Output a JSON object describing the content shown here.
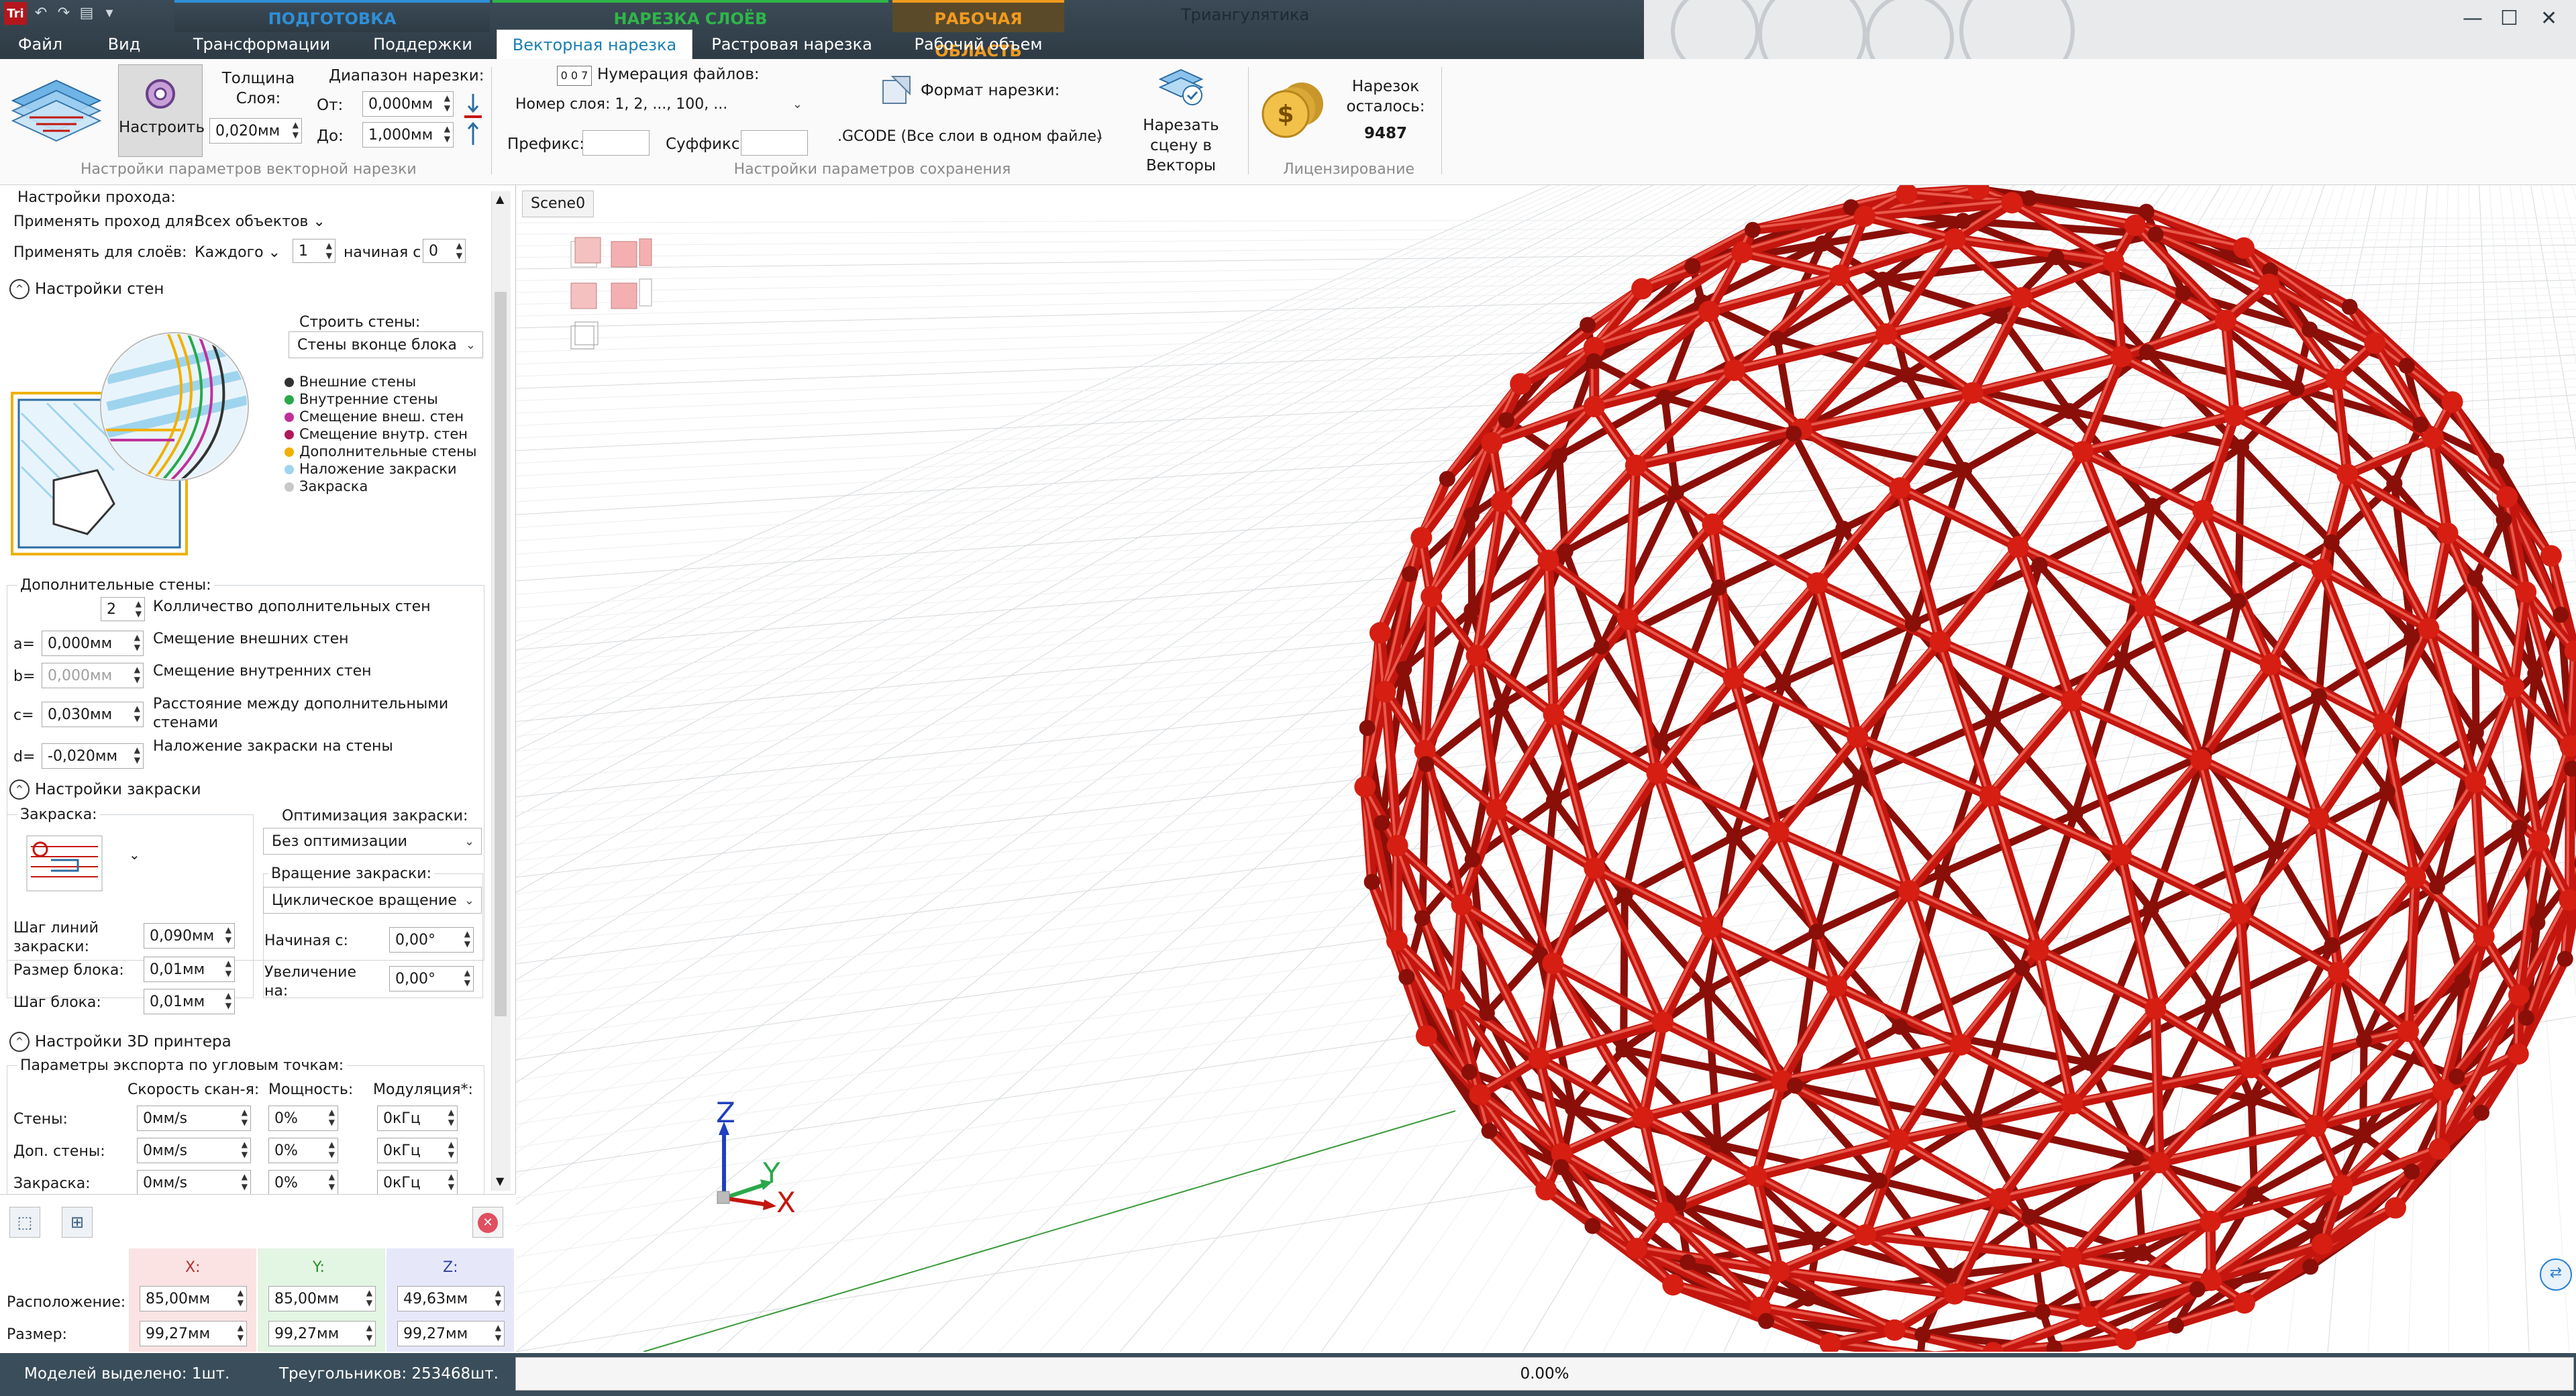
{
  "window": {
    "title": "Триангулятика"
  },
  "quick_access": {
    "logo": "Tri",
    "icons": [
      "undo-icon",
      "redo-icon",
      "flag-icon",
      "dropdown-icon"
    ]
  },
  "context_groups": [
    {
      "label": "ПОДГОТОВКА",
      "color": "#2f8fd8"
    },
    {
      "label": "НАРЕЗКА СЛОЁВ",
      "color": "#2fb54a"
    },
    {
      "label": "РАБОЧАЯ ОБЛАСТЬ",
      "color": "#f29a1f"
    }
  ],
  "tabs": [
    "Файл",
    "Вид",
    "Трансформации",
    "Поддержки",
    "Векторная нарезка",
    "Растровая нарезка",
    "Рабочий объем"
  ],
  "active_tab": "Векторная нарезка",
  "ribbon": {
    "configure_label": "Настроить",
    "layer_thickness_label": "Толщина Слоя:",
    "layer_thickness_value": "0,020мм",
    "range_label": "Диапазон нарезки:",
    "from_label": "От:",
    "from_value": "0,000мм",
    "to_label": "До:",
    "to_value": "1,000мм",
    "group1_label": "Настройки параметров векторной нарезки",
    "file_numbering_label": "Нумерация файлов:",
    "file_numbering_icon_text": "0 0 7",
    "layer_number_value": "Номер слоя: 1, 2, ..., 100, ...",
    "prefix_label": "Префикс:",
    "suffix_label": "Суффикс:",
    "format_label": "Формат нарезки:",
    "format_value": ".GCODE (Все слои в одном файле)",
    "slice_scene_label": "Нарезать сцену в Векторы",
    "group2_label": "Настройки параметров сохранения",
    "slices_left_label": "Нарезок осталось:",
    "slices_left_value": "9487",
    "group3_label": "Лицензирование"
  },
  "left": {
    "pass_settings": "Настройки прохода:",
    "apply_for_label": "Применять проход для:",
    "apply_for_value": "Всех объектов",
    "apply_layers_label": "Применять для слоёв:",
    "apply_layers_value": "Каждого",
    "layer_step": "1",
    "starting_label": "начиная с",
    "starting_value": "0",
    "walls_section": "Настройки стен",
    "build_walls_label": "Строить стены:",
    "build_walls_value": "Стены вконце блока",
    "legend": [
      {
        "label": "Внешние стены",
        "color": "#333333"
      },
      {
        "label": "Внутренние стены",
        "color": "#2aa84a"
      },
      {
        "label": "Смещение внеш. стен",
        "color": "#c0309a"
      },
      {
        "label": "Смещение внутр. стен",
        "color": "#b0185a"
      },
      {
        "label": "Дополнительные стены",
        "color": "#f0b000"
      },
      {
        "label": "Наложение закраски",
        "color": "#9fd4ee"
      },
      {
        "label": "Закраска",
        "color": "#c8c8c8"
      }
    ],
    "extra_walls_label": "Дополнительные стены:",
    "extra_count_value": "2",
    "extra_count_label": "Колличество дополнительных стен",
    "a_label": "a=",
    "a_value": "0,000мм",
    "a_desc": "Смещение внешних стен",
    "b_label": "b=",
    "b_value": "0,000мм",
    "b_desc": "Смещение внутренних стен",
    "c_label": "c=",
    "c_value": "0,030мм",
    "c_desc": "Расстояние между дополнительными стенами",
    "d_label": "d=",
    "d_value": "-0,020мм",
    "d_desc": "Наложение закраски на стены",
    "fill_section": "Настройки закраски",
    "fill_label": "Закраска:",
    "fill_opt_label": "Оптимизация закраски:",
    "fill_opt_value": "Без оптимизации",
    "fill_rot_label": "Вращение закраски:",
    "fill_rot_value": "Циклическое вращение",
    "line_step_label": "Шаг линий закраски:",
    "line_step_value": "0,090мм",
    "block_size_label": "Размер блока:",
    "block_size_value": "0,01мм",
    "block_step_label": "Шаг блока:",
    "block_step_value": "0,01мм",
    "start_at_label": "Начиная с:",
    "start_at_value": "0,00°",
    "increase_label": "Увеличение на:",
    "increase_value": "0,00°",
    "printer_section": "Настройки 3D принтера",
    "export_params_label": "Параметры экспорта по угловым точкам:",
    "col_speed": "Скорость скан-я:",
    "col_power": "Мощность:",
    "col_mod": "Модуляция*:",
    "rows": [
      {
        "label": "Стены:",
        "speed": "0мм/s",
        "power": "0%",
        "mod": "0кГц"
      },
      {
        "label": "Доп. стены:",
        "speed": "0мм/s",
        "power": "0%",
        "mod": "0кГц"
      },
      {
        "label": "Закраска:",
        "speed": "0мм/s",
        "power": "0%",
        "mod": "0кГц"
      }
    ]
  },
  "transform": {
    "x_header": "X:",
    "y_header": "Y:",
    "z_header": "Z:",
    "position_label": "Расположение:",
    "size_label": "Размер:",
    "pos_x": "85,00мм",
    "pos_y": "85,00мм",
    "pos_z": "49,63мм",
    "size_x": "99,27мм",
    "size_y": "99,27мм",
    "size_z": "99,27мм",
    "x_color": "#fbe3e3",
    "y_color": "#e3f5e3",
    "z_color": "#e6e8fa"
  },
  "viewport": {
    "scene_tab": "Scene0",
    "axes": {
      "x": "X",
      "y": "Y",
      "z": "Z"
    },
    "model_color": "#c4160e"
  },
  "status": {
    "models_selected": "Моделей выделено: 1шт.",
    "triangles": "Треугольников: 253468шт.",
    "progress": "0.00%"
  }
}
